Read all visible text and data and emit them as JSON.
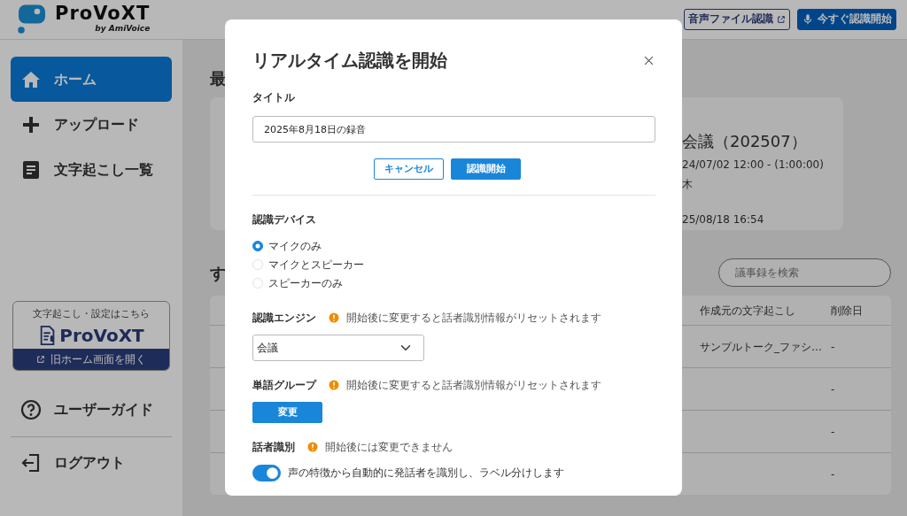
{
  "header": {
    "logo": {
      "name": "ProVoXT",
      "byline": "by AmiVoice"
    },
    "buttons": [
      {
        "label": "音声ファイル認識",
        "kind": "outline"
      },
      {
        "label": "今すぐ認識開始",
        "kind": "primary"
      }
    ]
  },
  "sidebar": {
    "items": [
      {
        "label": "ホーム",
        "kind": "home",
        "selected": true
      },
      {
        "label": "アップロード",
        "kind": "plus",
        "selected": false
      },
      {
        "label": "文字起こし一覧",
        "kind": "list",
        "selected": false
      }
    ],
    "promo": {
      "caption": "文字起こし・設定はこちら",
      "logo": "ProVoXT",
      "link": "旧ホーム画面を開く"
    },
    "footer_items": [
      {
        "label": "ユーザーガイド",
        "kind": "help"
      },
      {
        "label": "ログアウト",
        "kind": "logout"
      }
    ]
  },
  "main": {
    "recent_heading": "最",
    "recent_card": {
      "title": "会議（202507）",
      "datetime": "24/07/02 12:00 - (1:00:00)",
      "person": "木",
      "updated": "25/08/18 16:54"
    },
    "list_heading": "す",
    "search": {
      "placeholder": "議事録を検索"
    },
    "table": {
      "columns": [
        "作成元の文字起こし",
        "削除日"
      ],
      "rows": [
        {
          "source": "サンプルトーク_ファシ…",
          "deleted": "-"
        },
        {
          "deleted": "-"
        },
        {
          "deleted": "-"
        },
        {
          "deleted": "-"
        }
      ]
    }
  },
  "dialog": {
    "title": "リアルタイム認識を開始",
    "title_field": {
      "label": "タイトル",
      "value": "2025年8月18日の録音"
    },
    "buttons": [
      {
        "label": "キャンセル",
        "kind": "outline"
      },
      {
        "label": "認識開始",
        "kind": "primary"
      }
    ],
    "device": {
      "label": "認識デバイス",
      "options": [
        {
          "label": "マイクのみ",
          "selected": true
        },
        {
          "label": "マイクとスピーカー",
          "selected": false
        },
        {
          "label": "スピーカーのみ",
          "selected": false
        }
      ]
    },
    "engine": {
      "label": "認識エンジン",
      "note": "開始後に変更すると話者識別情報がリセットされます",
      "value": "会議"
    },
    "word_group": {
      "label": "単語グループ",
      "note": "開始後に変更すると話者識別情報がリセットされます",
      "button": "変更"
    },
    "speaker": {
      "label": "話者識別",
      "note": "開始後には変更できません",
      "toggle": {
        "label": "声の特徴から自動的に発話者を識別し、ラベル分けします",
        "on": true
      }
    }
  }
}
